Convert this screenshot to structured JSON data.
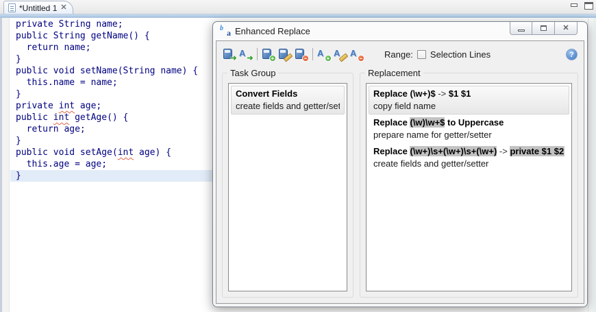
{
  "editor": {
    "tab": {
      "title": "*Untitled 1",
      "close_glyph": "✕"
    },
    "code_lines": [
      "private String name;",
      "public String getName() {",
      "  return name;",
      "}",
      "public void setName(String name) {",
      "  this.name = name;",
      "}",
      "private int age;",
      "public int getAge() {",
      "  return age;",
      "}",
      "public void setAge(int age) {",
      "  this.age = age;",
      "}"
    ],
    "selected_line_index": 13,
    "misspelled_word": "int"
  },
  "dialog": {
    "title": "Enhanced Replace",
    "toolbar": {
      "icons": [
        {
          "name": "run-group-icon",
          "base": "book",
          "badge": "arrow",
          "sep_after": false
        },
        {
          "name": "run-all-icon",
          "base": "letters",
          "badge": "arrow",
          "sep_after": true
        },
        {
          "name": "add-group-icon",
          "base": "book",
          "badge": "plus",
          "sep_after": false
        },
        {
          "name": "edit-group-icon",
          "base": "book",
          "badge": "pencil",
          "sep_after": false
        },
        {
          "name": "remove-group-icon",
          "base": "book",
          "badge": "minus",
          "sep_after": true
        },
        {
          "name": "add-replacement-icon",
          "base": "letters",
          "badge": "plus",
          "sep_after": false
        },
        {
          "name": "edit-replacement-icon",
          "base": "letters",
          "badge": "pencil",
          "sep_after": false
        },
        {
          "name": "remove-replacement-icon",
          "base": "letters",
          "badge": "minus",
          "sep_after": false
        }
      ],
      "range_label": "Range:",
      "selection_checkbox_checked": false,
      "selection_label": "Selection Lines",
      "help_glyph": "?"
    },
    "task_group": {
      "label": "Task Group",
      "items": [
        {
          "selected": true,
          "title": "Convert Fields",
          "desc": "create fields and getter/setter"
        }
      ]
    },
    "replacement": {
      "label": "Replacement",
      "items": [
        {
          "selected": true,
          "title_segments": [
            {
              "text": "Replace ",
              "bold": true,
              "chip": false
            },
            {
              "text": "(\\w+)$",
              "bold": true,
              "chip": false
            },
            {
              "text": " -> ",
              "bold": false,
              "chip": false
            },
            {
              "text": "$1 $1",
              "bold": true,
              "chip": false
            }
          ],
          "desc": "copy field name"
        },
        {
          "selected": false,
          "title_segments": [
            {
              "text": "Replace ",
              "bold": true,
              "chip": false
            },
            {
              "text": "(\\w)\\w+$",
              "bold": true,
              "chip": true
            },
            {
              "text": " to Uppercase",
              "bold": true,
              "chip": false
            }
          ],
          "desc": "prepare name for getter/setter"
        },
        {
          "selected": false,
          "title_segments": [
            {
              "text": "Replace ",
              "bold": true,
              "chip": false
            },
            {
              "text": "(\\w+)\\s+(\\w+)\\s+(\\w+)",
              "bold": true,
              "chip": true
            },
            {
              "text": " -> ",
              "bold": false,
              "chip": false
            },
            {
              "text": "private $1 $2;\\r\\n",
              "bold": true,
              "chip": true
            }
          ],
          "desc": "create fields and getter/setter"
        }
      ]
    },
    "caption": {
      "minimize": "minimize",
      "restore": "restore",
      "close": "✕"
    }
  },
  "colors": {
    "code_text": "#000080",
    "selected_line_bg": "#E2ECF8",
    "squiggle": "#E0644A",
    "chip_bg": "#C2C2C2",
    "dialog_bg": "#F0F0F0",
    "tab_underline": "#9FBDDC"
  }
}
